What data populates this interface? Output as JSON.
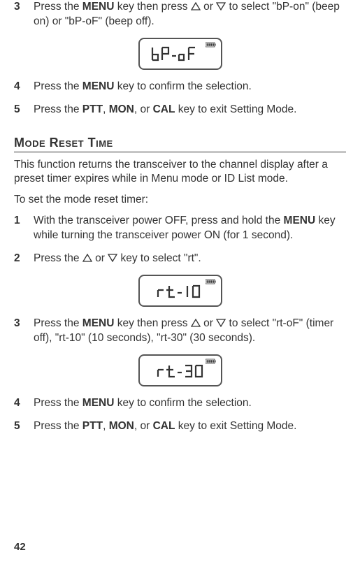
{
  "section1": {
    "step3_num": "3",
    "step3_a": "Press the ",
    "step3_menu": "MENU",
    "step3_b": " key then press ",
    "step3_c": " or ",
    "step3_d": " to select \"bP-on\" (beep on) or \"bP-oF\" (beep off).",
    "lcd1": "bP-oF",
    "step4_num": "4",
    "step4_a": "Press the ",
    "step4_menu": "MENU",
    "step4_b": " key to confirm the selection.",
    "step5_num": "5",
    "step5_a": "Press the ",
    "step5_ptt": "PTT",
    "step5_c": ", ",
    "step5_mon": "MON",
    "step5_d": ", or ",
    "step5_cal": "CAL",
    "step5_e": " key to exit Setting Mode."
  },
  "section2": {
    "title": "Mode Reset Time",
    "intro": "This function returns the transceiver to the channel display after a preset timer expires while in Menu mode or ID List mode.",
    "lead": "To set the mode reset timer:",
    "step1_num": "1",
    "step1_a": "With the transceiver power OFF, press and hold the ",
    "step1_menu": "MENU",
    "step1_b": " key while turning the transceiver power ON (for 1 second).",
    "step2_num": "2",
    "step2_a": "Press the ",
    "step2_b": " or ",
    "step2_c": " key to select \"rt\".",
    "lcd2": "rt-10",
    "step3_num": "3",
    "step3_a": "Press the ",
    "step3_menu": "MENU",
    "step3_b": " key then press ",
    "step3_c": " or ",
    "step3_d": " to select \"rt-oF\" (timer off), \"rt-10\" (10 seconds), \"rt-30\" (30 seconds).",
    "lcd3": "rt-30",
    "step4_num": "4",
    "step4_a": "Press the ",
    "step4_menu": "MENU",
    "step4_b": " key to confirm the selection.",
    "step5_num": "5",
    "step5_a": "Press the ",
    "step5_ptt": "PTT",
    "step5_c": ", ",
    "step5_mon": "MON",
    "step5_d": ", or ",
    "step5_cal": "CAL",
    "step5_e": " key to exit Setting Mode."
  },
  "page_number": "42"
}
